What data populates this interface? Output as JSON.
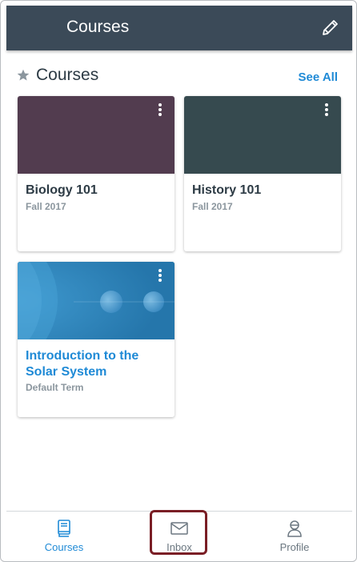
{
  "appbar": {
    "title": "Courses",
    "edit_icon": "pencil-icon"
  },
  "section": {
    "title": "Courses",
    "see_all": "See All",
    "icon": "star-icon"
  },
  "cards": [
    {
      "title": "Biology 101",
      "term": "Fall 2017",
      "color": "#523c4f"
    },
    {
      "title": "History 101",
      "term": "Fall 2017",
      "color": "#364a4f"
    },
    {
      "title": "Introduction to the Solar System",
      "term": "Default Term",
      "color": "#2a7bb0"
    }
  ],
  "tabs": [
    {
      "label": "Courses",
      "icon": "book-icon",
      "active": true
    },
    {
      "label": "Inbox",
      "icon": "envelope-icon",
      "active": false
    },
    {
      "label": "Profile",
      "icon": "user-icon",
      "active": false
    }
  ],
  "colors": {
    "accent": "#1f8ad6",
    "header": "#3b4a58",
    "highlight": "#7a1e25",
    "inactive": "#6b7780"
  }
}
